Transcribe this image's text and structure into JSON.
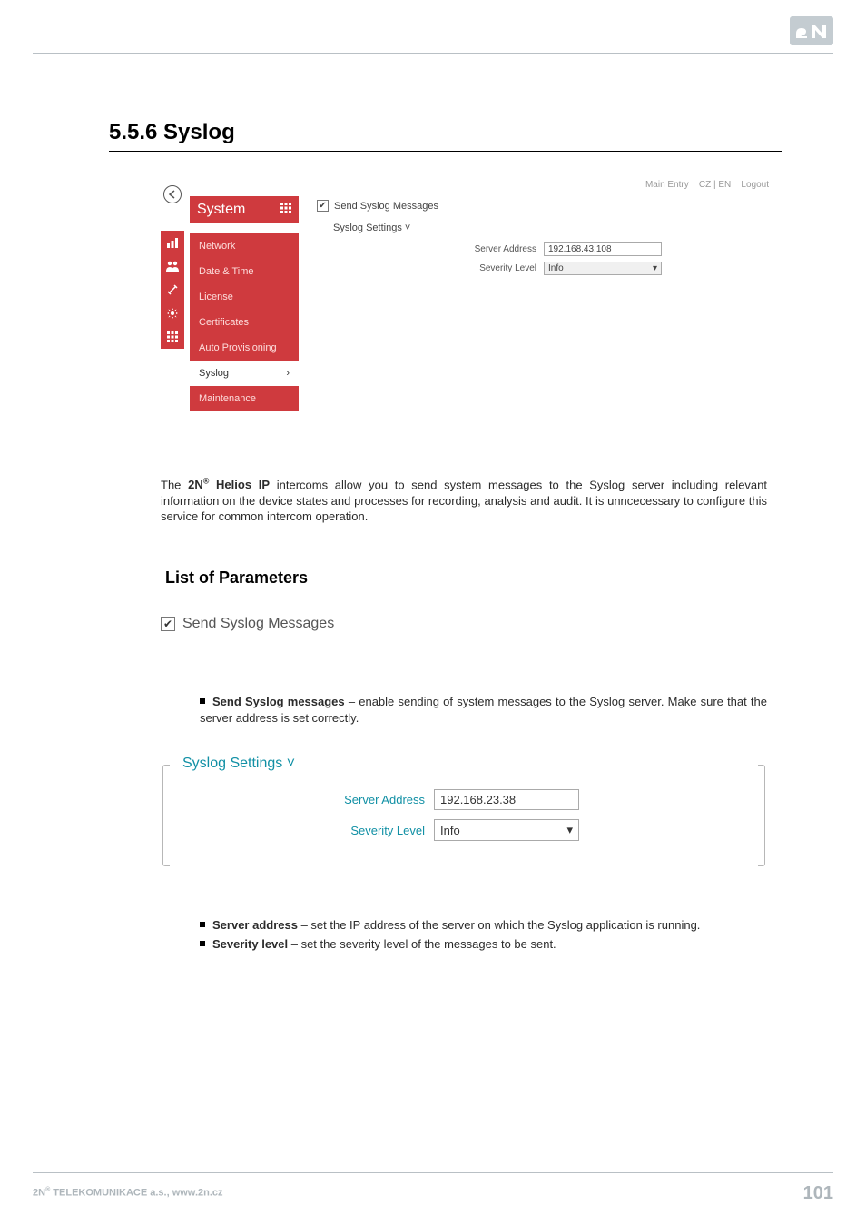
{
  "heading": "5.5.6 Syslog",
  "shot1": {
    "topbar": {
      "main_entry": "Main Entry",
      "lang": "CZ | EN",
      "logout": "Logout"
    },
    "system_label": "System",
    "menu": {
      "network": "Network",
      "date_time": "Date & Time",
      "license": "License",
      "certificates": "Certificates",
      "auto_provisioning": "Auto Provisioning",
      "syslog": "Syslog",
      "maintenance": "Maintenance"
    },
    "send_label": "Send Syslog Messages",
    "settings_head": "Syslog Settings ˅",
    "server_address_label": "Server Address",
    "server_address_value": "192.168.43.108",
    "severity_label": "Severity Level",
    "severity_value": "Info"
  },
  "para1": {
    "pre": "The ",
    "brand": "2N",
    "brand2": " Helios IP",
    "post": " intercoms allow you to send system messages to the Syslog server including relevant information on the device states and processes for recording, analysis and audit. It is unncecessary to configure this service for common intercom operation."
  },
  "h2": "List of Parameters",
  "shot2": {
    "label": "Send Syslog Messages"
  },
  "bul1": {
    "strong": "Send Syslog messages",
    "rest": " – enable sending of system messages to the Syslog server. Make sure that the server address is set correctly."
  },
  "shot3": {
    "legend": "Syslog Settings ˅",
    "server_address_label": "Server Address",
    "server_address_value": "192.168.23.38",
    "severity_label": "Severity Level",
    "severity_value": "Info"
  },
  "bul2": {
    "a_strong": "Server address",
    "a_rest": " – set the IP address of the server on which the Syslog application is running.",
    "b_strong": "Severity level",
    "b_rest": " – set the severity level of the messages to be sent."
  },
  "footer": {
    "left_pre": "2N",
    "left_post": " TELEKOMUNIKACE a.s., www.2n.cz",
    "page": "101"
  }
}
